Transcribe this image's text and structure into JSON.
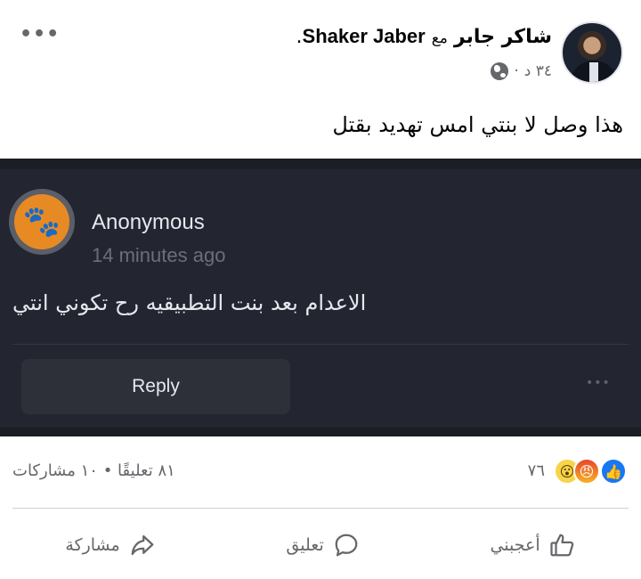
{
  "post": {
    "author": "شاكر جابر",
    "with_word": "مع",
    "tagged": "Shaker Jaber",
    "tag_suffix": ".",
    "time": "٣٤ د",
    "dot": "·",
    "text": "هذا وصل لا بنتي امس تهديد بقتل",
    "more_label": "•••"
  },
  "shared_comment": {
    "name": "Anonymous",
    "time_ago": "14 minutes ago",
    "text": "الاعدام بعد بنت التطبيقيه رح تكوني انتي",
    "reply_label": "Reply",
    "more_label": "•••"
  },
  "stats": {
    "reaction_count": "٧٦",
    "comments": "٨١ تعليقًا",
    "separator": "•",
    "shares": "١٠ مشاركات",
    "reactions": [
      "like",
      "angry",
      "wow"
    ]
  },
  "actions": {
    "like": "أعجبني",
    "comment": "تعليق",
    "share": "مشاركة"
  },
  "colors": {
    "like_blue": "#1877f2",
    "dark_card": "#232630",
    "anon_avatar": "#e88a24"
  }
}
